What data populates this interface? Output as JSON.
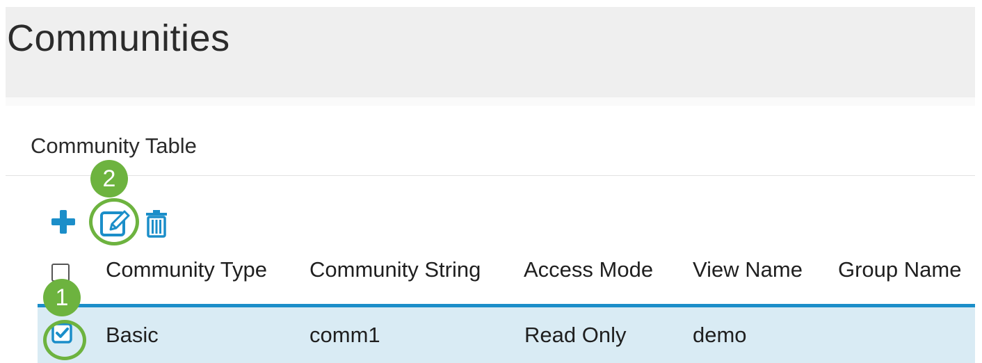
{
  "page": {
    "title": "Communities"
  },
  "section": {
    "title": "Community Table"
  },
  "toolbar": {
    "add_icon": "plus-icon",
    "edit_icon": "edit-icon",
    "delete_icon": "trash-icon"
  },
  "callouts": {
    "edit": "2",
    "select": "1"
  },
  "table": {
    "columns": [
      "Community Type",
      "Community String",
      "Access Mode",
      "View Name",
      "Group Name"
    ],
    "rows": [
      {
        "selected": true,
        "community_type": "Basic",
        "community_string": "comm1",
        "access_mode": "Read Only",
        "view_name": "demo",
        "group_name": ""
      }
    ]
  },
  "colors": {
    "accent": "#1b8ec9",
    "callout": "#6db33f",
    "selected_row": "#d9ebf4",
    "header_bg": "#efefef"
  }
}
